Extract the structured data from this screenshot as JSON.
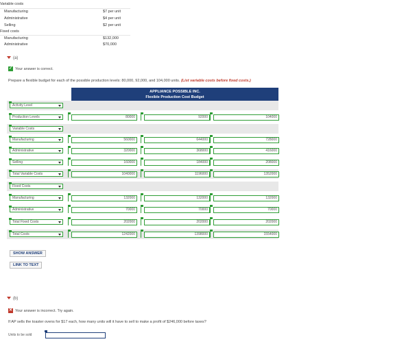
{
  "costs": {
    "variable_heading": "Variable costs",
    "variable": [
      {
        "label": "Manufacturing",
        "value": "$7 per unit"
      },
      {
        "label": "Administrative",
        "value": "$4 per unit"
      },
      {
        "label": "Selling",
        "value": "$2 per unit"
      }
    ],
    "fixed_heading": "Fixed costs",
    "fixed": [
      {
        "label": "Manufacturing",
        "value": "$132,000"
      },
      {
        "label": "Administrative",
        "value": "$70,000"
      }
    ]
  },
  "part_a": {
    "toggle": "(a)",
    "status": "Your answer is correct.",
    "prompt": "Prepare a flexible budget for each of the possible production levels: 80,000, 92,000, and 104,000 units.",
    "prompt_note": "(List variable costs before fixed costs.)",
    "table_title": "APPLIANCE POSSIBLE INC.",
    "table_subtitle": "Flexible Production Cost Budget",
    "rows": [
      {
        "label": "Activity Level",
        "values": []
      },
      {
        "label": "Production Levels",
        "values": [
          "80000",
          "92000",
          "104000"
        ]
      },
      {
        "label": "Variable Costs",
        "values": []
      },
      {
        "label": "Manufacturing",
        "values": [
          "560000",
          "644000",
          "728000"
        ]
      },
      {
        "label": "Administrative",
        "values": [
          "320000",
          "368000",
          "416000"
        ]
      },
      {
        "label": "Selling",
        "values": [
          "160000",
          "184000",
          "208000"
        ]
      },
      {
        "label": "Total Variable Costs",
        "values": [
          "1040000",
          "1196000",
          "1352000"
        ]
      },
      {
        "label": "Fixed Costs",
        "values": []
      },
      {
        "label": "Manufacturing",
        "values": [
          "132000",
          "132000",
          "132000"
        ]
      },
      {
        "label": "Administrative",
        "values": [
          "70000",
          "70000",
          "70000"
        ]
      },
      {
        "label": "Total Fixed Costs",
        "values": [
          "202000",
          "202000",
          "202000"
        ]
      },
      {
        "label": "Total Costs",
        "values": [
          "1242000",
          "1398000",
          "1554000"
        ]
      }
    ],
    "show_answer": "SHOW ANSWER",
    "link_to_text": "LINK TO TEXT"
  },
  "part_b": {
    "toggle": "(b)",
    "status": "Your answer is incorrect.  Try again.",
    "prompt": "If AP sells the toaster ovens for $17 each, how many units will it have to sell to make a profit of $246,000 before taxes?",
    "answer_label": "Units to be sold",
    "answer_value": ""
  },
  "colors": {
    "correct": "#2e9d35",
    "incorrect": "#c0392b",
    "header": "#1f3f7a"
  }
}
